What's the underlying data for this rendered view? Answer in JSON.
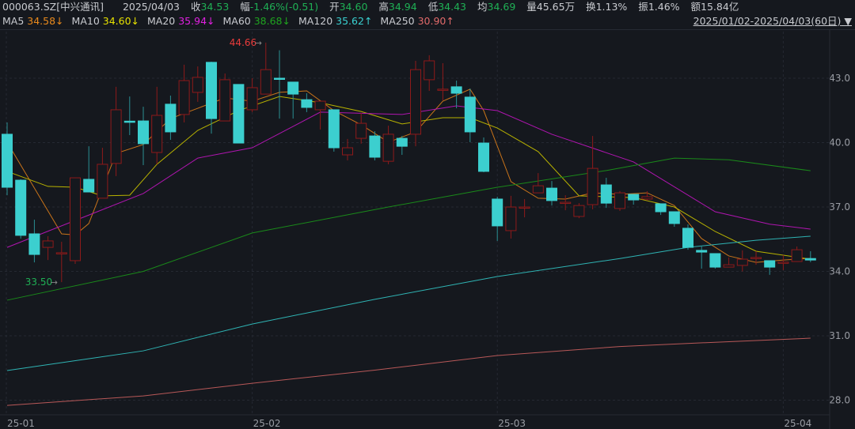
{
  "header": {
    "symbol": "000063.SZ[中兴通讯]",
    "date": "2025/04/03",
    "close_label": "收",
    "close": "34.53",
    "change_label": "幅",
    "change": "-1.46%(-0.51)",
    "open_label": "开",
    "open": "34.60",
    "high_label": "高",
    "high": "34.94",
    "low_label": "低",
    "low": "34.43",
    "avg_label": "均",
    "avg": "34.69",
    "volume_label": "量",
    "volume": "45.65万",
    "turnover_label": "换",
    "turnover": "1.13%",
    "amplitude_label": "振",
    "amplitude": "1.46%",
    "amount_label": "额",
    "amount": "15.84亿"
  },
  "ma_legend": [
    {
      "label": "MA5",
      "value": "34.58↓",
      "color": "#e8891c"
    },
    {
      "label": "MA10",
      "value": "34.60↓",
      "color": "#e6e000"
    },
    {
      "label": "MA20",
      "value": "35.94↓",
      "color": "#e020e0"
    },
    {
      "label": "MA60",
      "value": "38.68↓",
      "color": "#1fa31f"
    },
    {
      "label": "MA120",
      "value": "35.62↑",
      "color": "#3ad2d2"
    },
    {
      "label": "MA250",
      "value": "30.90↑",
      "color": "#e06a6a"
    }
  ],
  "date_range": "2025/01/02-2025/04/03(60日)",
  "date_range_dropdown_icon": "triangle-down-icon",
  "colors": {
    "up": "#8e1a1a",
    "down": "#3ccfcf",
    "bg": "#15181e"
  },
  "chart_data": {
    "type": "candlestick",
    "yticks": [
      "43.0",
      "40.0",
      "37.0",
      "34.0",
      "31.0",
      "28.0"
    ],
    "ylim": [
      27.2,
      45.2
    ],
    "xticks": [
      {
        "label": "25-01",
        "index": 0
      },
      {
        "label": "25-02",
        "index": 18
      },
      {
        "label": "25-03",
        "index": 36
      },
      {
        "label": "25-04",
        "index": 57
      }
    ],
    "max_annotation": {
      "label": "44.66",
      "index": 19
    },
    "min_annotation": {
      "label": "33.50",
      "index": 4
    },
    "ohlc": [
      [
        40.39,
        40.94,
        37.55,
        37.92
      ],
      [
        38.25,
        38.29,
        35.53,
        35.68
      ],
      [
        35.75,
        36.41,
        34.42,
        34.79
      ],
      [
        35.12,
        35.64,
        34.53,
        35.42
      ],
      [
        34.87,
        35.38,
        33.5,
        34.87
      ],
      [
        34.5,
        38.36,
        34.35,
        38.36
      ],
      [
        38.29,
        39.83,
        37.7,
        37.7
      ],
      [
        37.41,
        39.76,
        37.41,
        38.99
      ],
      [
        39.03,
        42.6,
        38.44,
        41.53
      ],
      [
        41.0,
        42.15,
        40.35,
        40.97
      ],
      [
        41.01,
        41.67,
        38.95,
        39.95
      ],
      [
        39.54,
        42.6,
        38.99,
        41.27
      ],
      [
        41.79,
        42.19,
        40.13,
        40.5
      ],
      [
        41.31,
        43.63,
        40.94,
        42.89
      ],
      [
        42.34,
        43.55,
        41.9,
        43.04
      ],
      [
        43.74,
        43.77,
        40.42,
        41.12
      ],
      [
        41.01,
        43.22,
        41.01,
        42.93
      ],
      [
        42.71,
        42.71,
        39.98,
        39.98
      ],
      [
        41.53,
        43.0,
        41.42,
        42.56
      ],
      [
        42.26,
        44.66,
        42.26,
        43.4
      ],
      [
        43.0,
        44.3,
        41.12,
        42.96
      ],
      [
        42.82,
        42.82,
        41.12,
        42.26
      ],
      [
        42.0,
        42.3,
        41.42,
        41.64
      ],
      [
        41.53,
        41.93,
        40.61,
        41.93
      ],
      [
        41.53,
        41.53,
        39.58,
        39.76
      ],
      [
        39.43,
        40.17,
        39.17,
        39.76
      ],
      [
        40.2,
        41.38,
        39.95,
        40.9
      ],
      [
        40.31,
        40.53,
        39.17,
        39.32
      ],
      [
        39.13,
        40.79,
        38.99,
        40.39
      ],
      [
        40.2,
        40.31,
        39.43,
        39.83
      ],
      [
        40.39,
        43.81,
        39.83,
        43.4
      ],
      [
        42.93,
        44.07,
        42.41,
        43.81
      ],
      [
        42.45,
        43.7,
        41.97,
        42.49
      ],
      [
        42.6,
        42.89,
        41.6,
        42.3
      ],
      [
        42.12,
        42.52,
        40.02,
        40.5
      ],
      [
        39.98,
        40.24,
        38.62,
        38.66
      ],
      [
        37.37,
        37.48,
        35.42,
        36.12
      ],
      [
        35.9,
        37.52,
        35.53,
        37.0
      ],
      [
        37.0,
        37.37,
        36.52,
        37.0
      ],
      [
        37.66,
        38.58,
        37.66,
        37.99
      ],
      [
        37.88,
        38.21,
        37.07,
        37.3
      ],
      [
        37.22,
        37.55,
        36.85,
        37.22
      ],
      [
        36.56,
        37.18,
        36.48,
        37.07
      ],
      [
        37.11,
        40.31,
        36.89,
        38.8
      ],
      [
        38.03,
        38.36,
        36.96,
        37.18
      ],
      [
        36.93,
        37.74,
        36.82,
        37.66
      ],
      [
        37.59,
        37.59,
        37.11,
        37.33
      ],
      [
        37.37,
        37.74,
        37.3,
        37.48
      ],
      [
        37.15,
        37.15,
        36.63,
        36.78
      ],
      [
        36.78,
        36.78,
        36.08,
        36.23
      ],
      [
        36.01,
        36.19,
        35.01,
        35.12
      ],
      [
        34.98,
        35.16,
        34.13,
        34.9
      ],
      [
        34.83,
        34.83,
        34.13,
        34.2
      ],
      [
        34.2,
        34.65,
        34.2,
        34.31
      ],
      [
        34.28,
        34.98,
        34.0,
        34.57
      ],
      [
        34.61,
        34.94,
        34.31,
        34.65
      ],
      [
        34.5,
        34.5,
        33.84,
        34.2
      ],
      [
        34.39,
        34.76,
        34.06,
        34.43
      ],
      [
        34.46,
        35.16,
        34.46,
        35.01
      ],
      [
        34.6,
        34.94,
        34.43,
        34.53
      ]
    ],
    "ma_lines": [
      {
        "name": "MA5",
        "color": "#c9741a",
        "points": [
          [
            0,
            40.02
          ],
          [
            4,
            35.75
          ],
          [
            5,
            35.7
          ],
          [
            6,
            36.23
          ],
          [
            8,
            39.5
          ],
          [
            10,
            39.91
          ],
          [
            12,
            41.12
          ],
          [
            14,
            41.6
          ],
          [
            16,
            42.08
          ],
          [
            18,
            41.93
          ],
          [
            20,
            42.34
          ],
          [
            22,
            42.41
          ],
          [
            24,
            41.49
          ],
          [
            26,
            40.83
          ],
          [
            28,
            40.02
          ],
          [
            30,
            40.5
          ],
          [
            32,
            41.93
          ],
          [
            34,
            42.49
          ],
          [
            35,
            41.49
          ],
          [
            37,
            38.18
          ],
          [
            39,
            37.41
          ],
          [
            41,
            37.37
          ],
          [
            43,
            37.66
          ],
          [
            45,
            37.59
          ],
          [
            47,
            37.66
          ],
          [
            49,
            37.07
          ],
          [
            51,
            35.53
          ],
          [
            53,
            34.72
          ],
          [
            55,
            34.42
          ],
          [
            57,
            34.53
          ],
          [
            59,
            34.61
          ]
        ]
      },
      {
        "name": "MA10",
        "color": "#b8b200",
        "points": [
          [
            0,
            38.66
          ],
          [
            3,
            37.96
          ],
          [
            5,
            37.92
          ],
          [
            7,
            37.52
          ],
          [
            9,
            37.55
          ],
          [
            11,
            38.99
          ],
          [
            14,
            40.57
          ],
          [
            17,
            41.49
          ],
          [
            20,
            42.15
          ],
          [
            23,
            41.86
          ],
          [
            26,
            41.45
          ],
          [
            29,
            40.87
          ],
          [
            32,
            41.16
          ],
          [
            34,
            41.16
          ],
          [
            36,
            40.68
          ],
          [
            39,
            39.58
          ],
          [
            42,
            37.52
          ],
          [
            46,
            37.44
          ],
          [
            49,
            37.0
          ],
          [
            52,
            35.86
          ],
          [
            55,
            34.94
          ],
          [
            59,
            34.57
          ]
        ]
      },
      {
        "name": "MA20",
        "color": "#b015b0",
        "points": [
          [
            0,
            35.12
          ],
          [
            10,
            37.63
          ],
          [
            14,
            39.28
          ],
          [
            18,
            39.76
          ],
          [
            23,
            41.42
          ],
          [
            29,
            41.31
          ],
          [
            33,
            41.71
          ],
          [
            36,
            41.49
          ],
          [
            40,
            40.39
          ],
          [
            46,
            39.1
          ],
          [
            52,
            36.78
          ],
          [
            56,
            36.2
          ],
          [
            59,
            35.97
          ]
        ]
      },
      {
        "name": "MA60",
        "color": "#1a8a1a",
        "points": [
          [
            0,
            32.66
          ],
          [
            10,
            34.0
          ],
          [
            18,
            35.79
          ],
          [
            28,
            37.0
          ],
          [
            36,
            37.92
          ],
          [
            44,
            38.7
          ],
          [
            49,
            39.28
          ],
          [
            53,
            39.2
          ],
          [
            59,
            38.69
          ]
        ]
      },
      {
        "name": "MA120",
        "color": "#2fb4b4",
        "points": [
          [
            0,
            29.38
          ],
          [
            10,
            30.3
          ],
          [
            18,
            31.55
          ],
          [
            27,
            32.7
          ],
          [
            36,
            33.76
          ],
          [
            45,
            34.6
          ],
          [
            50,
            35.12
          ],
          [
            55,
            35.45
          ],
          [
            59,
            35.64
          ]
        ]
      },
      {
        "name": "MA250",
        "color": "#b85858",
        "points": [
          [
            0,
            27.76
          ],
          [
            10,
            28.2
          ],
          [
            18,
            28.79
          ],
          [
            27,
            29.4
          ],
          [
            36,
            30.08
          ],
          [
            45,
            30.5
          ],
          [
            52,
            30.7
          ],
          [
            59,
            30.89
          ]
        ]
      }
    ]
  }
}
